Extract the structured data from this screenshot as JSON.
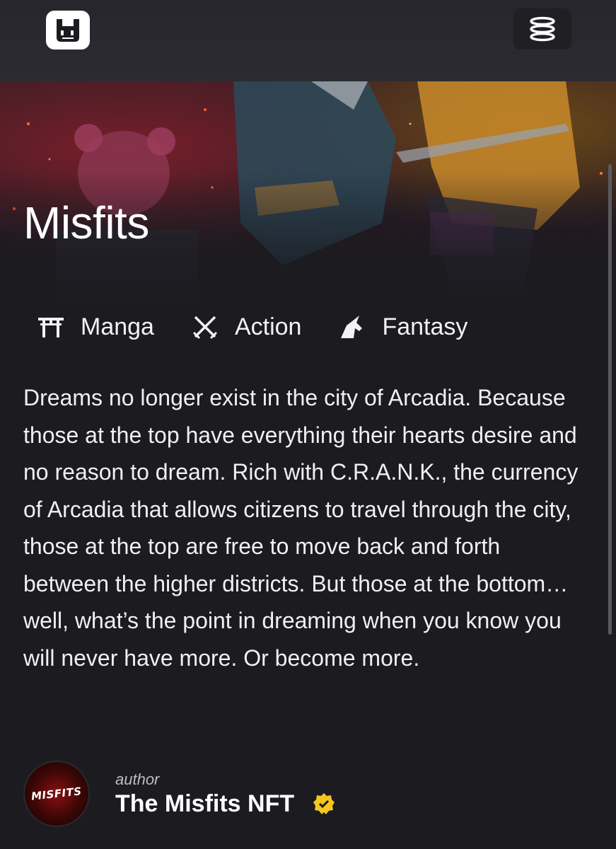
{
  "header": {
    "logo_icon": "bunny-logo-icon",
    "menu_icon": "stack-menu-icon"
  },
  "series": {
    "title": "Misfits",
    "tags": [
      {
        "label": "Manga",
        "icon": "torii-gate-icon"
      },
      {
        "label": "Action",
        "icon": "crossed-swords-icon"
      },
      {
        "label": "Fantasy",
        "icon": "unicorn-icon"
      }
    ],
    "description": "Dreams no longer exist in the city of Arcadia. Because those at the top have everything their hearts desire and no reason to dream. Rich with C.R.A.N.K., the currency of Arcadia that allows citizens to travel through the city, those at the top are free to move back and forth between the higher districts. But those at the bottom… well, what’s the point in dreaming when you know you will never have more. Or become more."
  },
  "author": {
    "role": "author",
    "name": "The Misfits NFT",
    "avatar_text": "MISFITS",
    "verified_icon": "verified-badge-icon"
  },
  "colors": {
    "background": "#1b1b20",
    "verified": "#f3c622"
  }
}
